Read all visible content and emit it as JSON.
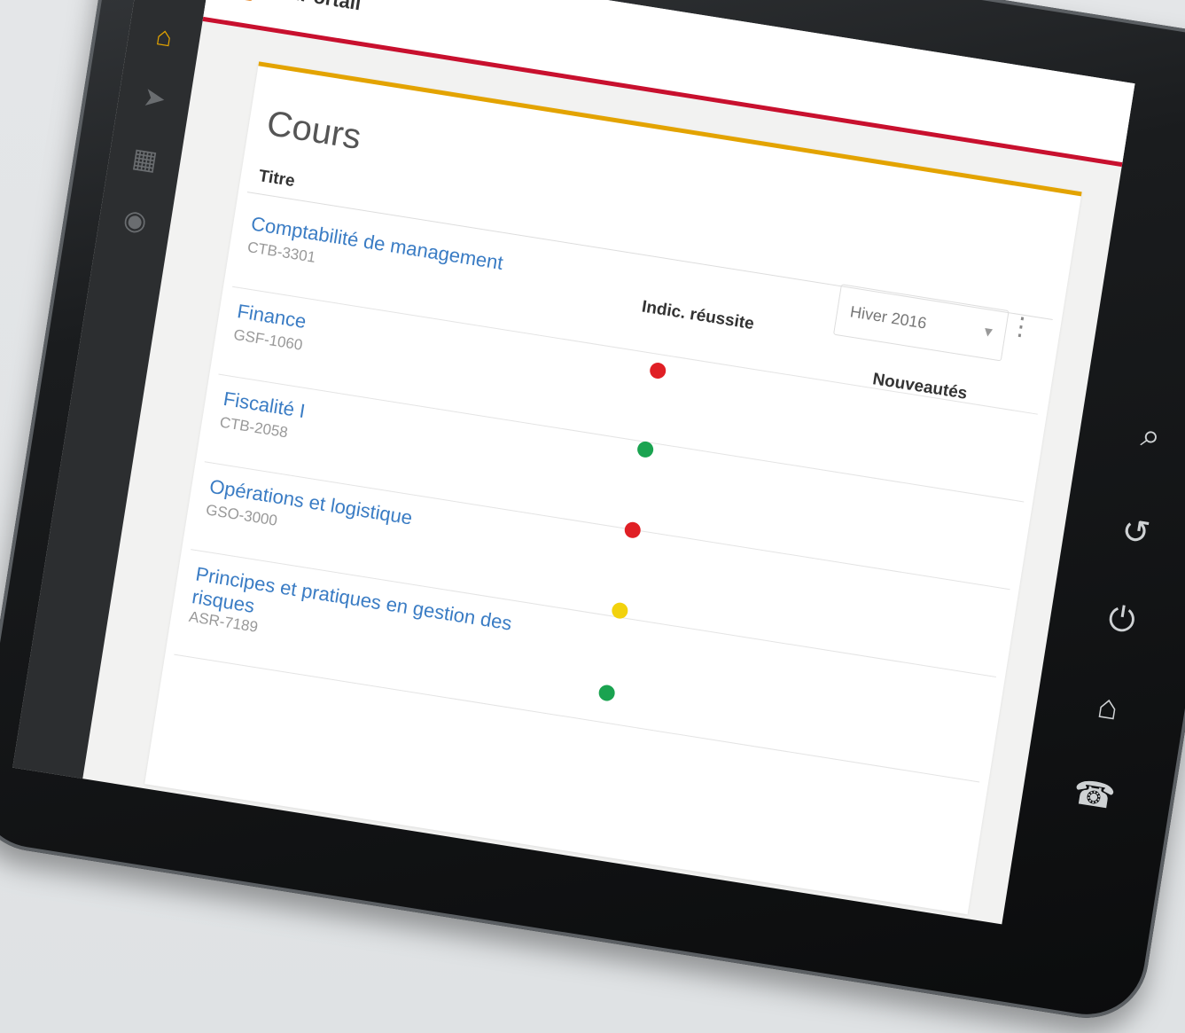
{
  "app": {
    "brand_prefix": "mon",
    "brand_name": "Portail"
  },
  "nav": {
    "items": [
      {
        "icon": "home-icon",
        "active": true
      },
      {
        "icon": "tag-icon",
        "active": false
      },
      {
        "icon": "calendar-icon",
        "active": false
      },
      {
        "icon": "eye-icon",
        "active": false
      }
    ]
  },
  "page": {
    "title": "Cours",
    "session_select": "Hiver 2016",
    "columns": {
      "title": "Titre",
      "indicator": "Indic. réussite",
      "news": "Nouveautés"
    }
  },
  "courses": [
    {
      "name": "Comptabilité de management",
      "code": "CTB-3301",
      "status": "red"
    },
    {
      "name": "Finance",
      "code": "GSF-1060",
      "status": "green"
    },
    {
      "name": "Fiscalité I",
      "code": "CTB-2058",
      "status": "red"
    },
    {
      "name": "Opérations et logistique",
      "code": "GSO-3000",
      "status": "yellow"
    },
    {
      "name": "Principes et pratiques en gestion des risques",
      "code": "ASR-7189",
      "status": "green"
    }
  ],
  "colors": {
    "accent_gold": "#e3a300",
    "accent_red": "#c8102e",
    "status_red": "#e01f25",
    "status_green": "#1aa350",
    "status_yellow": "#f2d20d",
    "link": "#3a7cc4"
  },
  "hardware_buttons": [
    "search-icon",
    "back-icon",
    "power-icon",
    "home-icon",
    "phone-icon"
  ]
}
